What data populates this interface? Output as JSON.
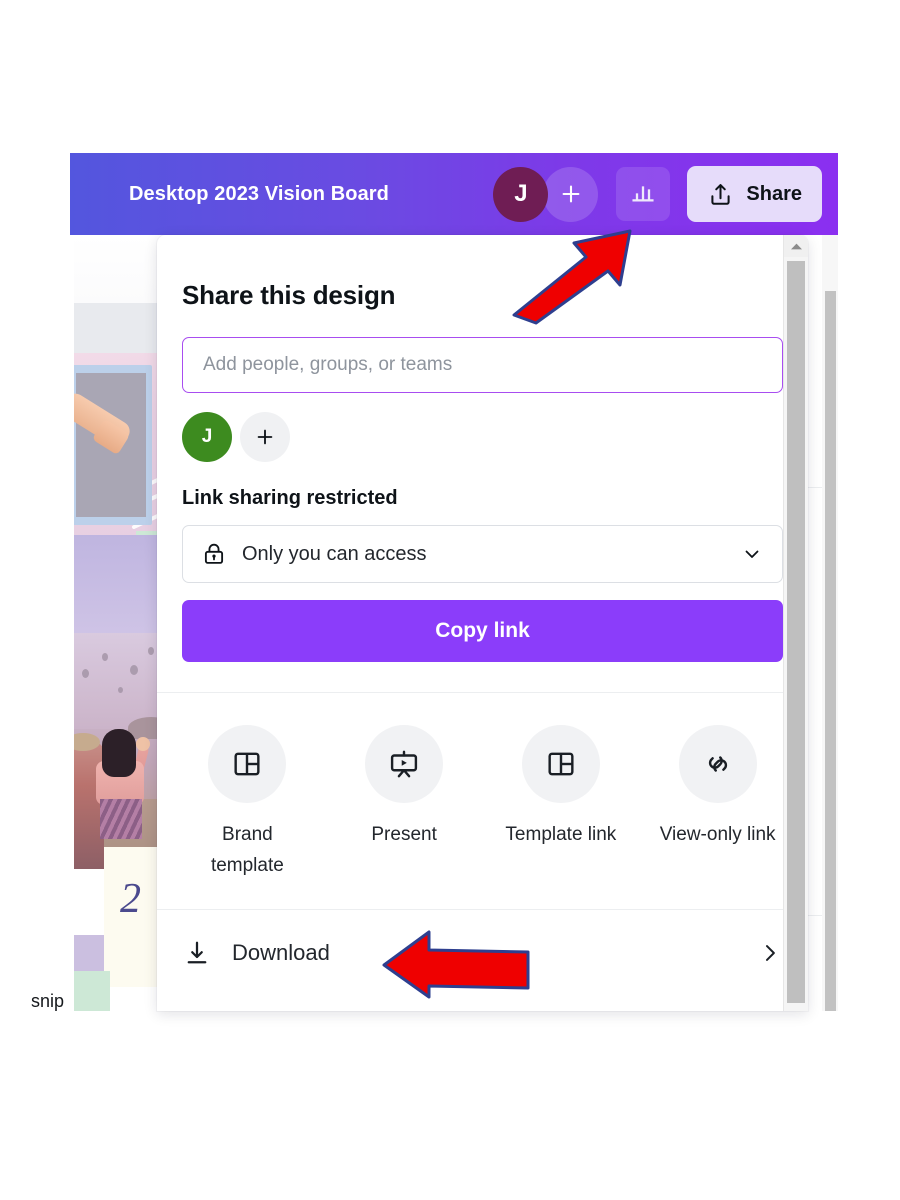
{
  "header": {
    "title": "Desktop 2023 Vision Board",
    "avatar_initial": "J",
    "avatar_color": "#6f1d54",
    "add_collaborator_icon": "plus-icon",
    "insights_icon": "bar-chart-icon",
    "share_icon": "upload-share-icon",
    "share_label": "Share",
    "gradient_from": "#5356de",
    "gradient_to": "#8b2ff0"
  },
  "share_panel": {
    "title": "Share this design",
    "people_input": {
      "placeholder": "Add people, groups, or teams",
      "value": "",
      "border_color": "#a84df0"
    },
    "collaborators": [
      {
        "initial": "J",
        "color": "#3d8b1f"
      }
    ],
    "add_collaborator_icon": "plus-icon",
    "link_section_label": "Link sharing restricted",
    "access_select": {
      "icon": "lock-icon",
      "value": "Only you can access",
      "chevron": "chevron-down-icon"
    },
    "copy_link_label": "Copy link",
    "copy_link_color": "#8b3dfa",
    "quick_actions": [
      {
        "icon": "brand-template-icon",
        "label": "Brand template"
      },
      {
        "icon": "present-icon",
        "label": "Present"
      },
      {
        "icon": "template-link-icon",
        "label": "Template link"
      },
      {
        "icon": "view-only-link-icon",
        "label": "View-only link"
      }
    ],
    "download": {
      "icon": "download-icon",
      "label": "Download",
      "chevron": "chevron-right-icon"
    }
  },
  "annotations": {
    "arrow_color": "#ef0000",
    "arrow_outline": "#2e3f8f",
    "arrow_up_target": "insights-icon",
    "arrow_left_target": "download-row"
  },
  "caption": {
    "snip_text": "snip"
  }
}
